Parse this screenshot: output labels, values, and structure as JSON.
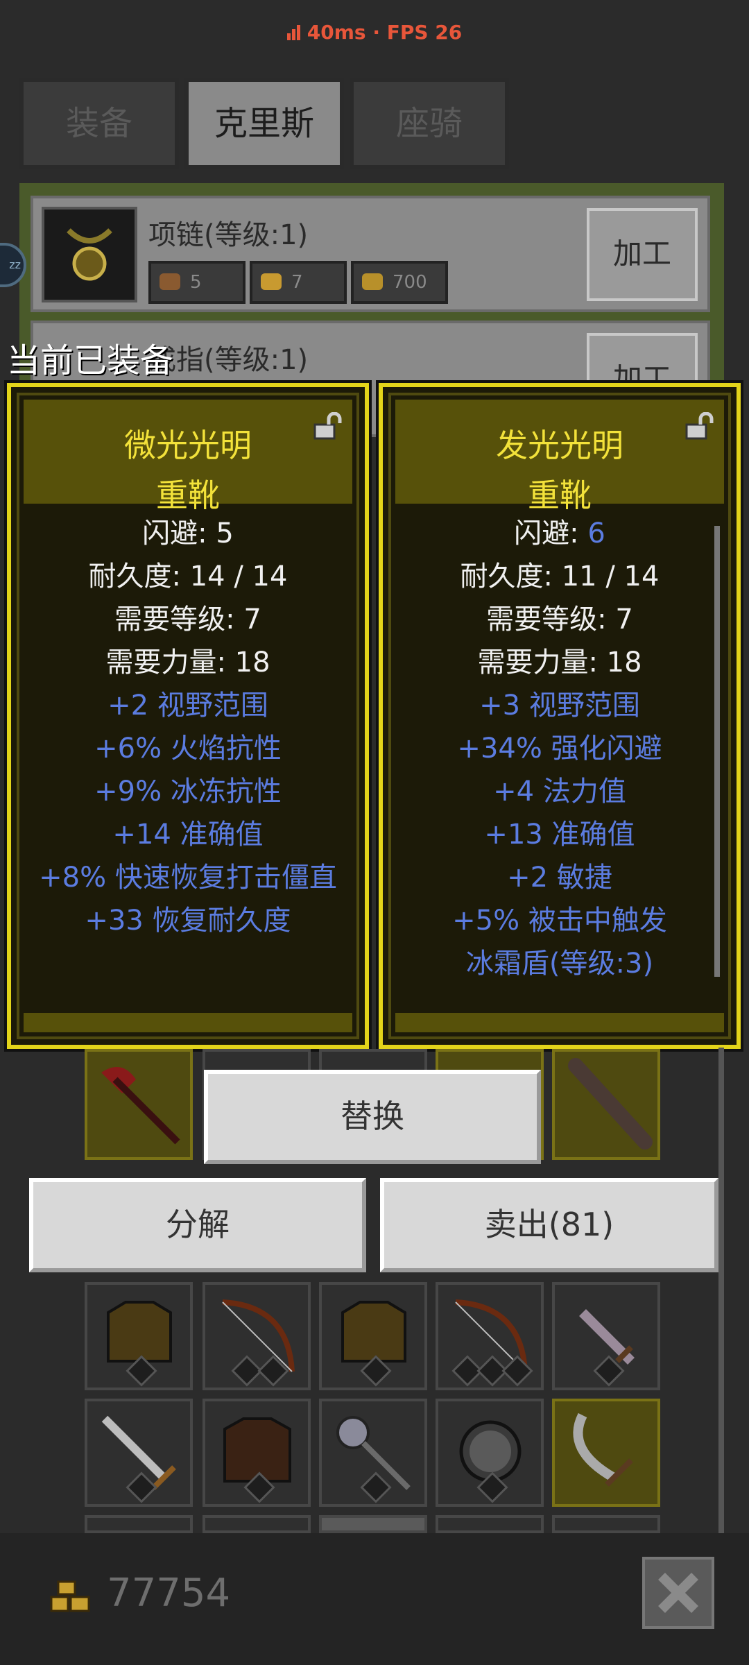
{
  "status": {
    "ping": "40ms",
    "separator": "·",
    "fps": "FPS 26"
  },
  "tabs": [
    {
      "label": "装备",
      "active": false
    },
    {
      "label": "克里斯",
      "active": true
    },
    {
      "label": "座骑",
      "active": false
    }
  ],
  "crafting": {
    "rows": [
      {
        "title": "项链(等级:1)",
        "costs": [
          {
            "icon": "ore-icon",
            "value": "5"
          },
          {
            "icon": "ingot-icon",
            "value": "7"
          },
          {
            "icon": "gold-icon",
            "value": "700"
          }
        ],
        "button": "加工"
      },
      {
        "title": "戒指(等级:1)",
        "button": "加工"
      }
    ]
  },
  "sleep_badge": "zz",
  "equipped_label": "当前已装备",
  "cards": [
    {
      "name": "微光光明",
      "type": "重靴",
      "base_stats": [
        "闪避: 5",
        "耐久度: 14 / 14",
        "需要等级: 7",
        "需要力量: 18"
      ],
      "bonus_stats": [
        "+2 视野范围",
        "+6% 火焰抗性",
        "+9% 冰冻抗性",
        "+14 准确值",
        "+8% 快速恢复打击僵直",
        "+33 恢复耐久度"
      ]
    },
    {
      "name": "发光光明",
      "type": "重靴",
      "dodge_label": "闪避: ",
      "dodge_value": "6",
      "base_stats": [
        "耐久度: 11 / 14",
        "需要等级: 7",
        "需要力量: 18"
      ],
      "bonus_stats": [
        "+3 视野范围",
        "+34% 强化闪避",
        "+4 法力值",
        "+13 准确值",
        "+2 敏捷",
        "+5% 被击中触发",
        "冰霜盾(等级:3)"
      ]
    }
  ],
  "actions": {
    "replace": "替换",
    "salvage": "分解",
    "sell": "卖出(81)"
  },
  "inventory": {
    "rows": [
      [
        "axe-icon",
        "empty",
        "empty",
        "empty",
        "club-icon"
      ],
      [
        "armor-icon",
        "bow-icon",
        "armor-icon",
        "bow-icon",
        "dagger-icon"
      ],
      [
        "sword-icon",
        "leather-armor-icon",
        "mace-icon",
        "shield-icon",
        "scimitar-icon"
      ]
    ]
  },
  "footer": {
    "gold": "77754"
  },
  "colors": {
    "accent_yellow": "#e3d41a",
    "bonus_blue": "#5b7ce0",
    "status_red": "#e8563a"
  }
}
